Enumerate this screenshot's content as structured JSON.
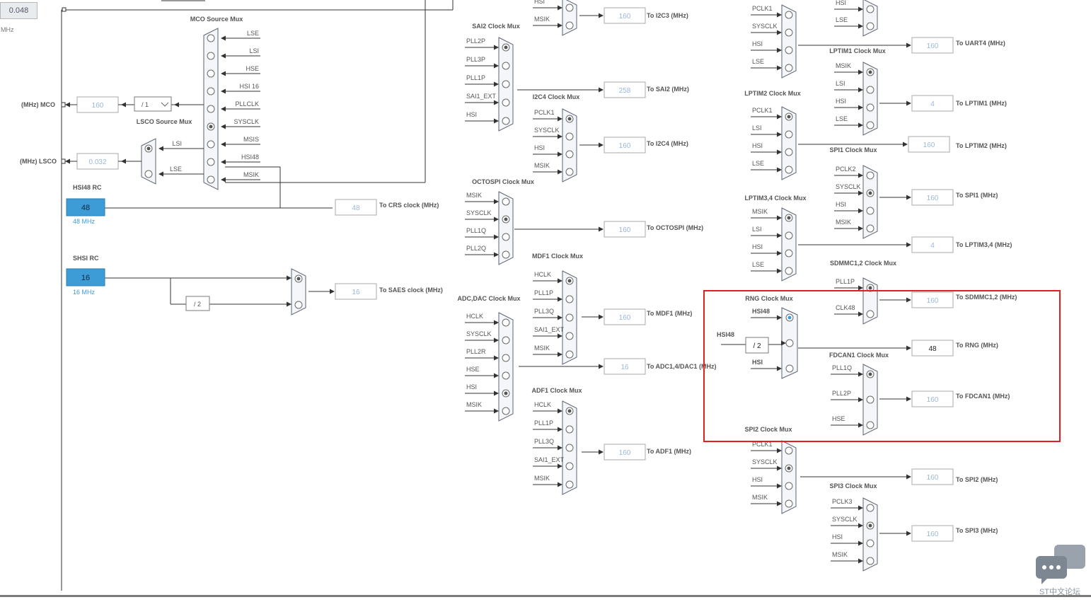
{
  "corner": {
    "value": "0.048",
    "unit": "MHz"
  },
  "colors": {
    "accent": "#3d9bd6",
    "highlight": "#e02020",
    "value_inactive": "#9ab8d8"
  },
  "chat": {
    "label": "ST中文论坛",
    "icon": "chat-bubble-icon"
  },
  "muxes": [
    {
      "id": "mco",
      "title": "MCO Source Mux",
      "inputs": [
        "LSE",
        "LSI",
        "HSE",
        "HSI 16",
        "PLLCLK",
        "SYSCLK",
        "MSIS",
        "HSI48",
        "MSIK"
      ],
      "selected": 5
    },
    {
      "id": "lsco",
      "title": "LSCO Source Mux",
      "inputs": [
        "LSI",
        "LSE"
      ],
      "selected": 0
    },
    {
      "id": "shsi",
      "title": "",
      "inputs": [
        "",
        ""
      ],
      "selected": 0
    },
    {
      "id": "i2c3",
      "title": "",
      "inputs": [
        "HSI",
        "MSIK"
      ],
      "selected": -1
    },
    {
      "id": "sai2",
      "title": "SAI2 Clock Mux",
      "inputs": [
        "PLL2P",
        "PLL3P",
        "PLL1P",
        "SAI1_EXT",
        "HSI"
      ],
      "selected": 0
    },
    {
      "id": "i2c4",
      "title": "I2C4 Clock Mux",
      "inputs": [
        "PCLK1",
        "SYSCLK",
        "HSI",
        "MSIK"
      ],
      "selected": 0
    },
    {
      "id": "octospi",
      "title": "OCTOSPI Clock Mux",
      "inputs": [
        "MSIK",
        "SYSCLK",
        "PLL1Q",
        "PLL2Q"
      ],
      "selected": 1
    },
    {
      "id": "mdf1",
      "title": "MDF1 Clock Mux",
      "inputs": [
        "HCLK",
        "PLL1P",
        "PLL3Q",
        "SAI1_EXT",
        "MSIK"
      ],
      "selected": 0
    },
    {
      "id": "adcdac",
      "title": "ADC,DAC Clock Mux",
      "inputs": [
        "HCLK",
        "SYSCLK",
        "PLL2R",
        "HSE",
        "HSI",
        "MSIK"
      ],
      "selected": 4
    },
    {
      "id": "adf1",
      "title": "ADF1 Clock Mux",
      "inputs": [
        "HCLK",
        "PLL1P",
        "PLL3Q",
        "SAI1_EXT",
        "MSIK"
      ],
      "selected": 0
    },
    {
      "id": "uart4",
      "title": "",
      "inputs": [
        "PCLK1",
        "SYSCLK",
        "HSI",
        "LSE"
      ],
      "selected": -1
    },
    {
      "id": "lptim2",
      "title": "LPTIM2 Clock Mux",
      "inputs": [
        "PCLK1",
        "LSI",
        "HSI",
        "LSE"
      ],
      "selected": 0
    },
    {
      "id": "lptim34",
      "title": "LPTIM3,4 Clock Mux",
      "inputs": [
        "MSIK",
        "LSI",
        "HSI",
        "LSE"
      ],
      "selected": 0
    },
    {
      "id": "rng",
      "title": "RNG Clock Mux",
      "inputs": [
        "HSI48",
        "",
        "HSI"
      ],
      "selected": 0
    },
    {
      "id": "spi2",
      "title": "SPI2 Clock Mux",
      "inputs": [
        "PCLK1",
        "SYSCLK",
        "HSI",
        "MSIK"
      ],
      "selected": 1
    },
    {
      "id": "c4top",
      "title": "",
      "inputs": [
        "HSI",
        "LSE"
      ],
      "selected": -1
    },
    {
      "id": "lptim1",
      "title": "LPTIM1 Clock Mux",
      "inputs": [
        "MSIK",
        "LSI",
        "HSI",
        "LSE"
      ],
      "selected": 0
    },
    {
      "id": "spi1",
      "title": "SPI1 Clock Mux",
      "inputs": [
        "PCLK2",
        "SYSCLK",
        "HSI",
        "MSIK"
      ],
      "selected": 1
    },
    {
      "id": "sdmmc",
      "title": "SDMMC1,2 Clock Mux",
      "inputs": [
        "PLL1P",
        "CLK48"
      ],
      "selected": 0
    },
    {
      "id": "fdcan1",
      "title": "FDCAN1 Clock Mux",
      "inputs": [
        "PLL1Q",
        "PLL2P",
        "HSE"
      ],
      "selected": 0
    },
    {
      "id": "spi3",
      "title": "SPI3 Clock Mux",
      "inputs": [
        "PCLK3",
        "SYSCLK",
        "HSI",
        "MSIK"
      ],
      "selected": 1
    }
  ],
  "outputs": [
    {
      "id": "mco",
      "label": "(MHz) MCO",
      "value": "160"
    },
    {
      "id": "lsco",
      "label": "(MHz) LSCO",
      "value": "0.032"
    },
    {
      "id": "crs",
      "label": "To CRS clock (MHz)",
      "value": "48"
    },
    {
      "id": "saes",
      "label": "To SAES clock (MHz)",
      "value": "16"
    },
    {
      "id": "i2c3",
      "label": "To I2C3 (MHz)",
      "value": "160"
    },
    {
      "id": "sai2",
      "label": "To SAI2 (MHz)",
      "value": "258"
    },
    {
      "id": "i2c4",
      "label": "To I2C4 (MHz)",
      "value": "160"
    },
    {
      "id": "octospi",
      "label": "To OCTOSPI (MHz)",
      "value": "160"
    },
    {
      "id": "mdf1",
      "label": "To MDF1 (MHz)",
      "value": "160"
    },
    {
      "id": "adc",
      "label": "To ADC1,4/DAC1 (MHz)",
      "value": "16"
    },
    {
      "id": "adf1",
      "label": "To ADF1 (MHz)",
      "value": "160"
    },
    {
      "id": "uart4",
      "label": "To UART4 (MHz)",
      "value": "160"
    },
    {
      "id": "lptim1",
      "label": "To LPTIM1 (MHz)",
      "value": "4"
    },
    {
      "id": "lptim2",
      "label": "To LPTIM2 (MHz)",
      "value": "160"
    },
    {
      "id": "spi1",
      "label": "To SPI1 (MHz)",
      "value": "160"
    },
    {
      "id": "lptim34",
      "label": "To LPTIM3,4 (MHz)",
      "value": "4"
    },
    {
      "id": "sdmmc",
      "label": "To SDMMC1,2 (MHz)",
      "value": "160"
    },
    {
      "id": "rng",
      "label": "To RNG (MHz)",
      "value": "48"
    },
    {
      "id": "fdcan1",
      "label": "To FDCAN1 (MHz)",
      "value": "160"
    },
    {
      "id": "spi2",
      "label": "To SPI2 (MHz)",
      "value": "160"
    },
    {
      "id": "spi3",
      "label": "To SPI3 (MHz)",
      "value": "160"
    }
  ],
  "rcs": [
    {
      "id": "hsi48",
      "title": "HSI48 RC",
      "value": "48",
      "sub": "48 MHz"
    },
    {
      "id": "shsi",
      "title": "SHSI RC",
      "value": "16",
      "sub": "16 MHz"
    }
  ],
  "dividers": {
    "mco_div": "/ 1",
    "shsi_div": "/ 2",
    "rng_div": "/ 2"
  },
  "rng_src_label": "HSI48"
}
